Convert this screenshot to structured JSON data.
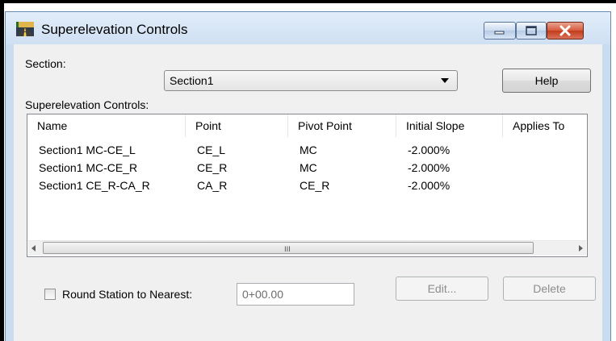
{
  "window": {
    "title": "Superelevation Controls",
    "icon": "road-icon"
  },
  "section": {
    "label": "Section:",
    "selected": "Section1"
  },
  "buttons": {
    "help": "Help",
    "edit": "Edit...",
    "delete": "Delete"
  },
  "controls_label": "Superelevation Controls:",
  "table": {
    "columns": [
      "Name",
      "Point",
      "Pivot Point",
      "Initial Slope",
      "Applies To"
    ],
    "rows": [
      [
        "Section1  MC-CE_L",
        "CE_L",
        "MC",
        "-2.000%",
        ""
      ],
      [
        "Section1  MC-CE_R",
        "CE_R",
        "MC",
        "-2.000%",
        ""
      ],
      [
        "Section1  CE_R-CA_R",
        "CA_R",
        "CE_R",
        "-2.000%",
        ""
      ]
    ]
  },
  "scrollbar": {
    "grip": "III"
  },
  "round_station": {
    "label": "Round Station to Nearest:",
    "checked": false,
    "value": "0+00.00"
  }
}
